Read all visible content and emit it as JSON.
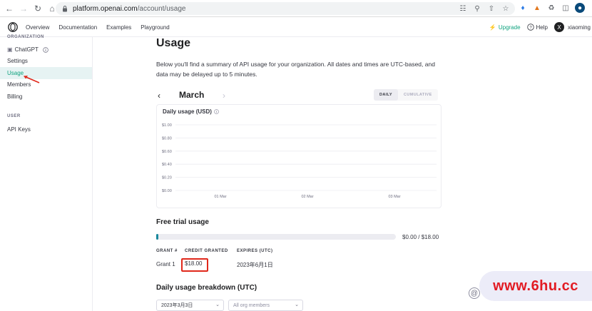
{
  "browser": {
    "url_host": "platform.openai.com",
    "url_path": "/account/usage"
  },
  "topnav": {
    "links": [
      "Overview",
      "Documentation",
      "Examples",
      "Playground"
    ],
    "upgrade": "Upgrade",
    "help": "Help",
    "user_initial": "X",
    "username": "xiaoming"
  },
  "sidebar": {
    "org_section": "ORGANIZATION",
    "items": [
      {
        "label": "ChatGPT"
      },
      {
        "label": "Settings"
      },
      {
        "label": "Usage"
      },
      {
        "label": "Members"
      },
      {
        "label": "Billing"
      }
    ],
    "user_section": "USER",
    "user_items": [
      {
        "label": "API Keys"
      }
    ]
  },
  "main": {
    "title": "Usage",
    "intro": "Below you'll find a summary of API usage for your organization. All dates and times are UTC-based, and data may be delayed up to 5 minutes.",
    "month": "March",
    "toggle": {
      "daily": "DAILY",
      "cumulative": "CUMULATIVE"
    },
    "chart_title": "Daily usage (USD)",
    "free_trial": {
      "title": "Free trial usage",
      "progress_label": "$0.00 / $18.00",
      "progress_fraction": 0.01,
      "headers": [
        "GRANT #",
        "CREDIT GRANTED",
        "EXPIRES (UTC)"
      ],
      "row": {
        "grant": "Grant 1",
        "credit": "$18.00",
        "expires": "2023年6月1日"
      }
    },
    "breakdown": {
      "title": "Daily usage breakdown (UTC)",
      "date_select": "2023年3月3日",
      "member_select": "All org members"
    }
  },
  "watermark": "www.6hu.cc",
  "colors": {
    "accent": "#10a37f",
    "progress": "#19889c",
    "annotation": "#e0281b",
    "watermark": "#e21b23"
  },
  "chart_data": {
    "type": "bar",
    "title": "Daily usage (USD)",
    "categories": [
      "01 Mar",
      "02 Mar",
      "03 Mar"
    ],
    "values": [
      0,
      0,
      0
    ],
    "y_ticks": [
      "$1.00",
      "$0.80",
      "$0.60",
      "$0.40",
      "$0.20",
      "$0.00"
    ],
    "ylim": [
      0,
      1
    ],
    "grid": true
  }
}
